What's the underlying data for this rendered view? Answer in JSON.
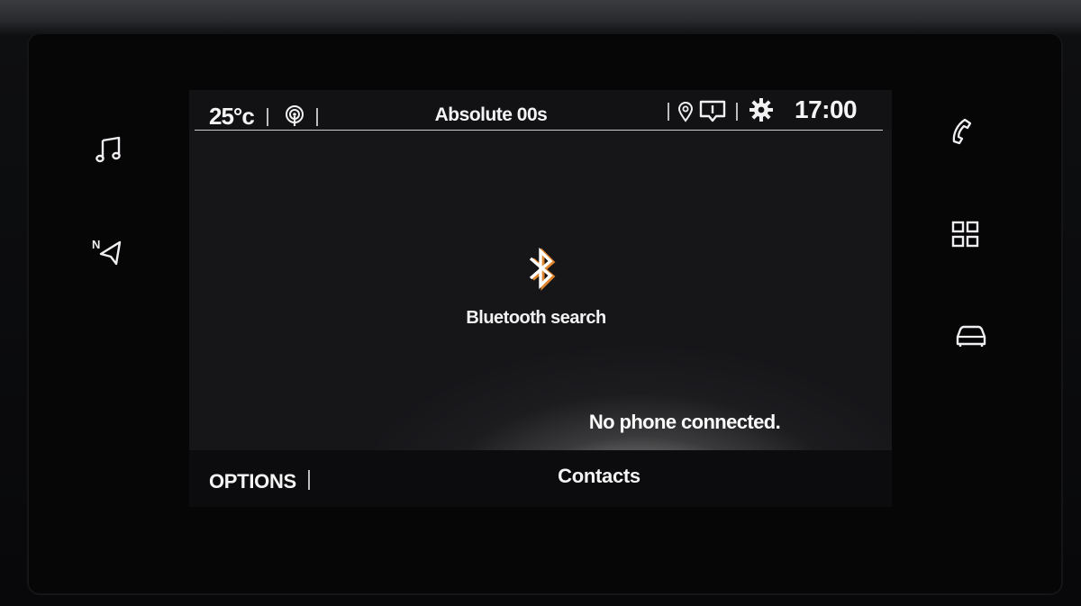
{
  "status_bar": {
    "temperature": "25°c",
    "station": "Absolute 00s",
    "time": "17:00",
    "icons": [
      "radio-signal-icon",
      "location-pin-icon",
      "message-icon",
      "settings-gear-icon"
    ]
  },
  "main": {
    "bluetooth_icon": "bluetooth-icon",
    "bluetooth_label": "Bluetooth search",
    "status_message": "No phone connected."
  },
  "bottom_bar": {
    "options_label": "OPTIONS",
    "contacts_label": "Contacts"
  },
  "left_buttons": [
    "music-note-icon",
    "navigation-north-icon"
  ],
  "right_buttons": [
    "phone-icon",
    "apps-grid-icon",
    "car-icon"
  ],
  "colors": {
    "text": "#f4f4f4",
    "accent_orange": "#e0852c",
    "screen_bg": "#161619"
  }
}
